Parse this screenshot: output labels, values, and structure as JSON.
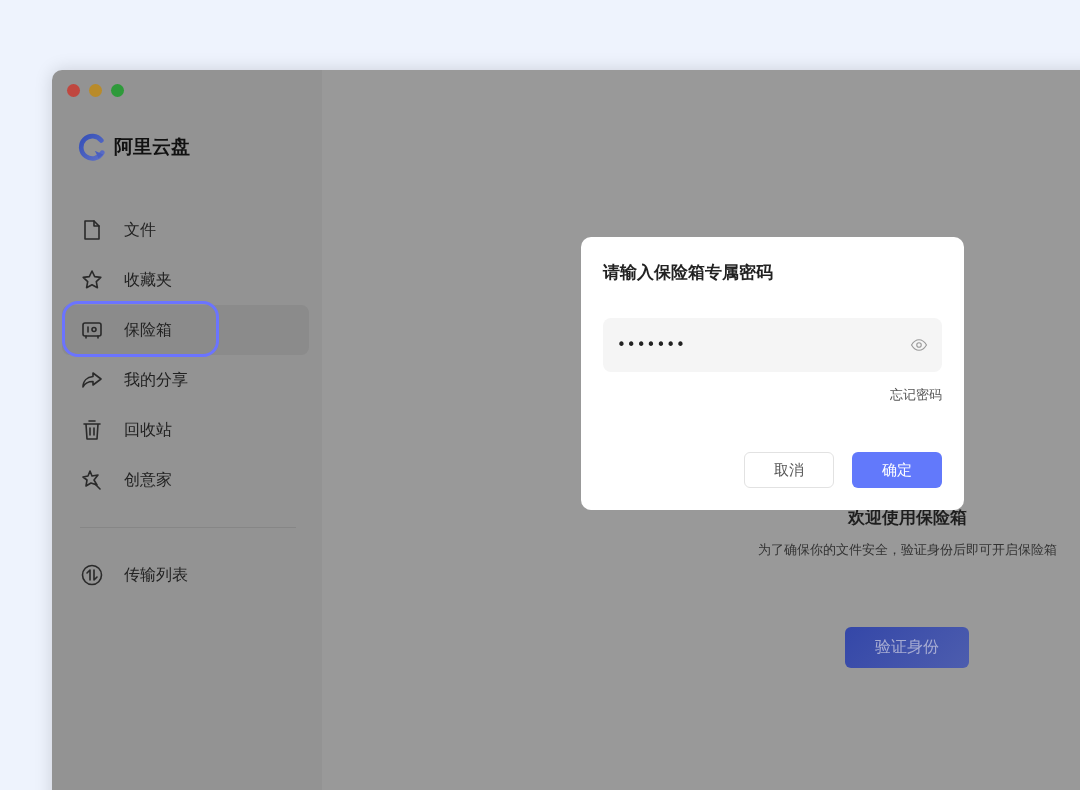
{
  "app": {
    "logo_text": "阿里云盘"
  },
  "sidebar": {
    "items": [
      {
        "label": "文件",
        "kind": "file",
        "selected": false,
        "highlighted": false
      },
      {
        "label": "收藏夹",
        "kind": "star",
        "selected": false,
        "highlighted": false
      },
      {
        "label": "保险箱",
        "kind": "safe",
        "selected": true,
        "highlighted": true
      },
      {
        "label": "我的分享",
        "kind": "share",
        "selected": false,
        "highlighted": false
      },
      {
        "label": "回收站",
        "kind": "trash",
        "selected": false,
        "highlighted": false
      },
      {
        "label": "创意家",
        "kind": "spark",
        "selected": false,
        "highlighted": false
      }
    ],
    "bottom_items": [
      {
        "label": "传输列表",
        "kind": "transfer",
        "selected": false,
        "highlighted": false
      }
    ]
  },
  "main": {
    "title": "欢迎使用保险箱",
    "subtitle": "为了确保你的文件安全，验证身份后即可开启保险箱",
    "button": "验证身份"
  },
  "dialog": {
    "title": "请输入保险箱专属密码",
    "password": {
      "value": "•••••••"
    },
    "forgot_link": "忘记密码",
    "buttons": [
      {
        "label": "取消",
        "kind": "secondary"
      },
      {
        "label": "确定",
        "kind": "primary"
      }
    ]
  }
}
